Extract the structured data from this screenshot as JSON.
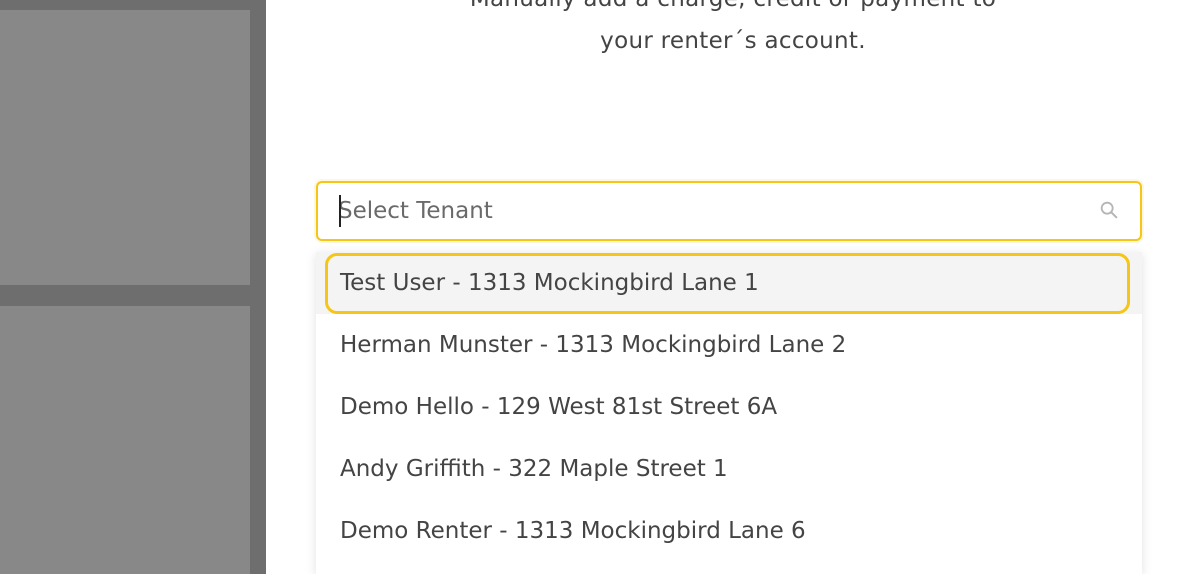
{
  "modal": {
    "description_line1": "Manually add a charge, credit or payment to",
    "description_line2": "your renter´s account."
  },
  "tenant_search": {
    "placeholder": "Select Tenant",
    "value": "",
    "icon": "search-icon",
    "accent_color": "#f5c518"
  },
  "tenant_options": [
    {
      "label": "Test User - 1313 Mockingbird Lane 1",
      "highlighted": true
    },
    {
      "label": "Herman Munster - 1313 Mockingbird Lane 2",
      "highlighted": false
    },
    {
      "label": "Demo Hello - 129 West 81st Street 6A",
      "highlighted": false
    },
    {
      "label": "Andy Griffith - 322 Maple Street 1",
      "highlighted": false
    },
    {
      "label": "Demo Renter - 1313 Mockingbird Lane 6",
      "highlighted": false
    }
  ]
}
